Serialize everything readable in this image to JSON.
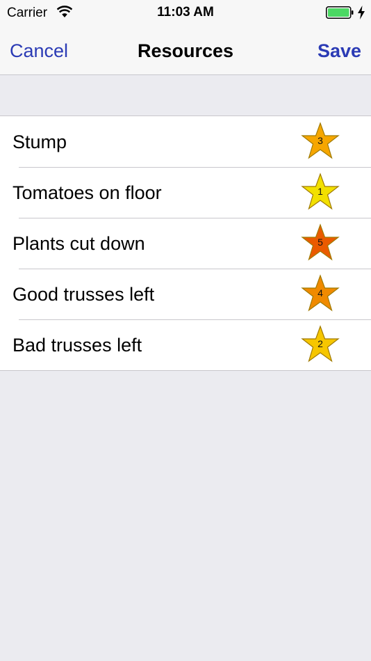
{
  "status_bar": {
    "carrier": "Carrier",
    "time": "11:03 AM"
  },
  "nav": {
    "cancel_label": "Cancel",
    "title": "Resources",
    "save_label": "Save"
  },
  "colors": {
    "nav_button": "#2b3bb5",
    "battery": "#4cd964",
    "star_rating_1": "#f2e000",
    "star_rating_2": "#f6c600",
    "star_rating_3": "#f6a600",
    "star_rating_4": "#f08a00",
    "star_rating_5": "#ea5a00"
  },
  "resources": [
    {
      "label": "Stump",
      "rating": "3"
    },
    {
      "label": "Tomatoes on floor",
      "rating": "1"
    },
    {
      "label": "Plants cut down",
      "rating": "5"
    },
    {
      "label": "Good trusses left",
      "rating": "4"
    },
    {
      "label": "Bad trusses left",
      "rating": "2"
    }
  ]
}
